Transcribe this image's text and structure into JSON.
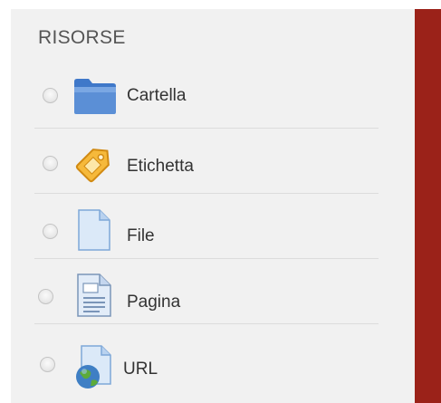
{
  "section": {
    "title": "RISORSE"
  },
  "items": [
    {
      "label": "Cartella",
      "icon": "folder-icon"
    },
    {
      "label": "Etichetta",
      "icon": "tag-icon"
    },
    {
      "label": "File",
      "icon": "file-icon"
    },
    {
      "label": "Pagina",
      "icon": "page-icon"
    },
    {
      "label": "URL",
      "icon": "url-globe-icon"
    }
  ],
  "colors": {
    "panel_bg": "#f1f1f1",
    "accent_bar": "#9b2219",
    "text": "#333333",
    "heading": "#555555",
    "folder_blue": "#5b8fd6",
    "tag_orange": "#f3a424"
  }
}
